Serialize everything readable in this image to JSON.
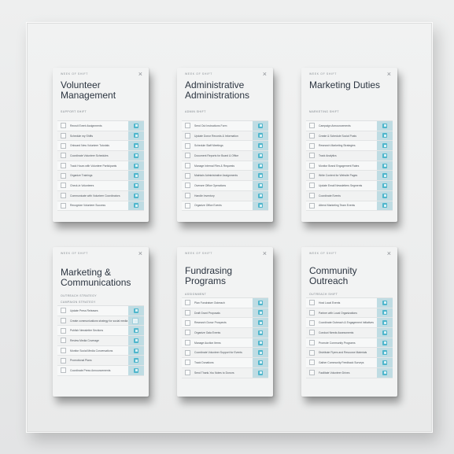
{
  "cards": [
    {
      "kicker": "WEEK OF SHIFT",
      "title": "Volunteer Management",
      "subtitle": "SUPPORT SHIFT",
      "subtitle2": "",
      "rows": [
        "Recruit Event Assignments",
        "Schedule my Shifts",
        "Onboard New Volunteer Tutorials",
        "Coordinate Volunteer Schedules",
        "Track Hours with Volunteer Participants",
        "Organize Trainings",
        "Check-in Volunteers",
        "Communicate with Volunteer Coordinators",
        "Recognize Volunteer Success"
      ]
    },
    {
      "kicker": "WEEK OF SHIFT",
      "title": "Administrative Administrations",
      "subtitle": "ADMIN SHIFT",
      "subtitle2": "",
      "rows": [
        "Send Out Instructions Form",
        "Update Donor Records & Information",
        "Schedule Staff Meetings",
        "Document Reports for Board & Office",
        "Manage Internal Files & Requests",
        "Maintain Administrative Assignments",
        "Oversee Office Operations",
        "Handle Inventory",
        "Organize Office Events"
      ]
    },
    {
      "kicker": "WEEK OF SHIFT",
      "title": "Marketing Duties",
      "subtitle": "MARKETING SHIFT",
      "subtitle2": "",
      "rows": [
        "Campaign Announcements",
        "Create & Schedule Social Posts",
        "Research Marketing Strategies",
        "Track Analytics",
        "Monitor Brand Engagement Rates",
        "Write Content for Website Pages",
        "Update Email Newsletters Segments",
        "Coordinate Events",
        "Attend Marketing Team Events"
      ]
    },
    {
      "kicker": "WEEK OF SHIFT",
      "title": "Marketing & Communications",
      "subtitle": "OUTREACH STRATEGY",
      "subtitle2": "CAMPAIGN STRATEGY",
      "rows": [
        "Update Press Releases",
        "Create communications strategy for social media outreach",
        "Publish Newsletter Sections",
        "Review Media Coverage",
        "Monitor Social Media Conversations",
        "Promotional Plans",
        "Coordinate Press Announcements"
      ]
    },
    {
      "kicker": "WEEK OF SHIFT",
      "title": "Fundrasing Programs",
      "subtitle": "ASSIGNMENT",
      "subtitle2": "",
      "rows": [
        "Plan Fundraiser Outreach",
        "Draft Grant Proposals",
        "Research Donor Prospects",
        "Organize Gala Events",
        "Manage Auction Items",
        "Coordinate Volunteer Support for Events",
        "Track Donations",
        "Send Thank-You Notes to Donors"
      ]
    },
    {
      "kicker": "WEEK OF SHIFT",
      "title": "Community Outreach",
      "subtitle": "OUTREACH SHIFT",
      "subtitle2": "",
      "rows": [
        "Host Local Events",
        "Partner with Local Organizations",
        "Coordinate Outreach & Engagement Initiatives",
        "Conduct Needs Assessments",
        "Promote Community Programs",
        "Distribute Flyers and Resource Materials",
        "Gather Community Feedback Surveys",
        "Facilitate Volunteer Drives"
      ]
    }
  ],
  "colors": {
    "accent": "#4fb6cc",
    "accent_column": "#bfdce3",
    "title_text": "#2b3440"
  },
  "icons": {
    "close": "close-icon",
    "checkbox": "checkbox-icon",
    "action": "task-action-icon"
  }
}
